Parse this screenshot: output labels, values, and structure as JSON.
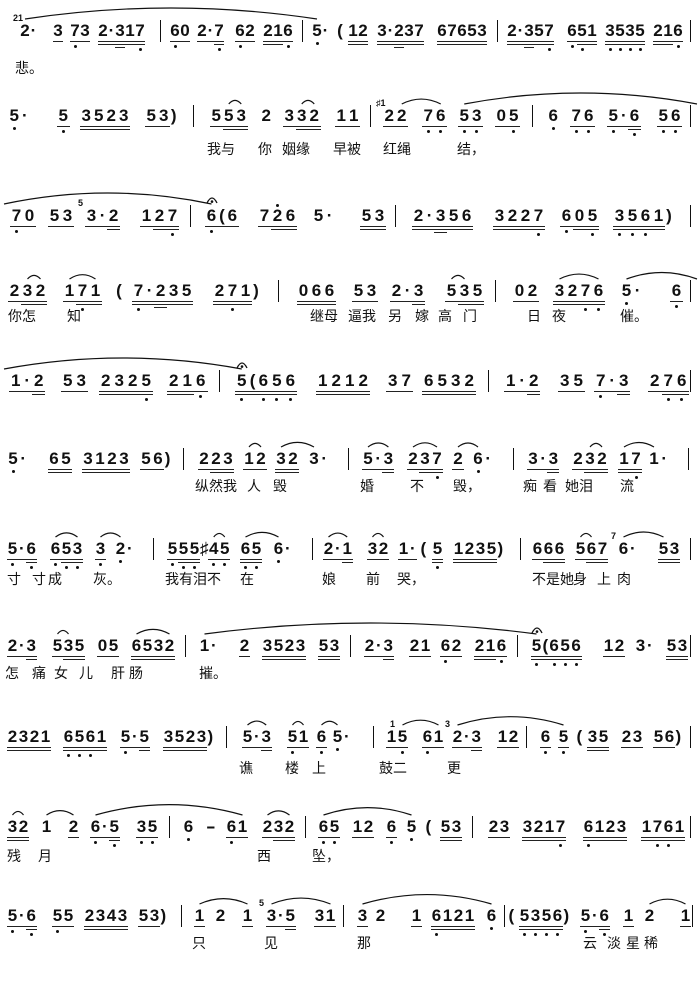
{
  "systems": [
    {
      "items": [
        {
          "t": "2·",
          "u": "00",
          "g": {
            "0": "21"
          },
          "s": "( "
        },
        {
          "t": "3",
          "u": "1"
        },
        {
          "t": "73",
          "u": "11",
          "o": ". "
        },
        {
          "t": "2·317",
          "u": "22322",
          "o": "    ."
        },
        {
          "bar": "|"
        },
        {
          "t": "60",
          "u": "11",
          "o": ". "
        },
        {
          "t": "2·7",
          "u": "112",
          "o": "  ."
        },
        {
          "t": "62",
          "u": "11",
          "o": ". "
        },
        {
          "t": "216",
          "u": "221",
          "o": "  ."
        },
        {
          "bar": "|"
        },
        {
          "t": "5·",
          "u": "00",
          "o": ". ",
          "s": ") "
        },
        {
          "t": "(",
          "u": "0"
        },
        {
          "t": "12",
          "u": "22"
        },
        {
          "t": "3·237",
          "u": "22322"
        },
        {
          "t": "67653",
          "u": "22222"
        },
        {
          "bar": "|"
        },
        {
          "t": "2·357",
          "u": "22322",
          "o": "    ."
        },
        {
          "t": "651",
          "u": "122",
          "o": ".. "
        },
        {
          "t": "3535",
          "u": "2222",
          "o": "...."
        },
        {
          "t": "216",
          "u": "221",
          "o": "  ."
        },
        {
          "bar": "|"
        }
      ],
      "lyrics": [
        {
          "text": "悲。"
        }
      ]
    },
    {
      "items": [
        {
          "t": "5·",
          "u": "00",
          "o": ". "
        },
        {
          "t": "5",
          "u": "1",
          "o": "."
        },
        {
          "t": "3523",
          "u": "2222"
        },
        {
          "t": "53)",
          "u": "110"
        },
        {
          "bar": "|"
        },
        {
          "t": "553",
          "u": "122",
          "s": " ()"
        },
        {
          "t": "2",
          "u": "0"
        },
        {
          "t": "332",
          "u": "122",
          "s": " ()"
        },
        {
          "t": "11",
          "u": "11"
        },
        {
          "bar": "|"
        },
        {
          "t": "22",
          "u": "11",
          "g": {
            "0": "♯1"
          },
          "s": " ("
        },
        {
          "t": "76",
          "u": "11",
          "o": "..",
          "s": " )"
        },
        {
          "t": "53",
          "u": "11",
          "o": "..",
          "s": "[ "
        },
        {
          "t": "05",
          "u": "11",
          "o": " ."
        },
        {
          "bar": "|"
        },
        {
          "t": "6",
          "u": "0",
          "o": "."
        },
        {
          "t": "76",
          "u": "11",
          "o": ".."
        },
        {
          "t": "5·6",
          "u": "112",
          "o": ". ."
        },
        {
          "t": "56",
          "u": "11",
          "o": ".."
        },
        {
          "bar": "|"
        }
      ],
      "lyrics": [
        {
          "text": "我与"
        },
        {
          "text": "你"
        },
        {
          "text": "姻缘"
        },
        {
          "text": "早被"
        },
        {
          "text": "红绳"
        },
        {
          "text": "结，"
        }
      ]
    },
    {
      "items": [
        {
          "t": "70",
          "u": "11",
          "o": ". "
        },
        {
          "t": "53",
          "u": "11"
        },
        {
          "t": "3·2",
          "u": "112",
          "g": {
            "0": "5"
          }
        },
        {
          "t": "127",
          "u": "122",
          "o": "  ."
        },
        {
          "bar": "|"
        },
        {
          "t": "6(6",
          "u": "111",
          "o": ".  ",
          "f": 0,
          "s": "]  "
        },
        {
          "t": "726",
          "u": "122",
          "o": " ' "
        },
        {
          "t": "5·",
          "u": "00"
        },
        {
          "t": "53",
          "u": "22"
        },
        {
          "bar": "|"
        },
        {
          "t": "2·356",
          "u": "22322"
        },
        {
          "t": "3227",
          "u": "2222",
          "o": "   ."
        },
        {
          "t": "605",
          "u": "122",
          "o": ". ."
        },
        {
          "t": "3561)",
          "u": "22220",
          "o": "...  "
        },
        {
          "bar": "|"
        }
      ],
      "lyrics": []
    },
    {
      "items": [
        {
          "t": "232",
          "u": "122",
          "s": " ()"
        },
        {
          "t": "171",
          "u": "122",
          "o": " . ",
          "s": "( )"
        },
        {
          "t": "(",
          "u": "0"
        },
        {
          "t": "7·235",
          "u": "22322",
          "o": ".    "
        },
        {
          "t": "271)",
          "u": "2220",
          "o": " .  "
        },
        {
          "bar": "|"
        },
        {
          "t": "066",
          "u": "222"
        },
        {
          "t": "53",
          "u": "11"
        },
        {
          "t": "2·3",
          "u": "112"
        },
        {
          "t": "535",
          "u": "122",
          "s": "() "
        },
        {
          "bar": "|"
        },
        {
          "t": "02",
          "u": "11"
        },
        {
          "t": "3276",
          "u": "2222",
          "o": "  ..",
          "s": "(  )"
        },
        {
          "t": "5·",
          "u": "00",
          "o": ". ",
          "s": "[ "
        },
        {
          "t": "6",
          "u": "1",
          "o": "."
        },
        {
          "bar": "|"
        }
      ],
      "lyrics": [
        {
          "text": "你怎"
        },
        {
          "text": "知"
        },
        {
          "text": "继母"
        },
        {
          "text": "逼我"
        },
        {
          "text": "另"
        },
        {
          "text": "嫁"
        },
        {
          "text": "高"
        },
        {
          "text": "门"
        },
        {
          "text": "日"
        },
        {
          "text": "夜"
        },
        {
          "text": "催。"
        }
      ]
    },
    {
      "items": [
        {
          "t": "1·2",
          "u": "112"
        },
        {
          "t": "53",
          "u": "11"
        },
        {
          "t": "2325",
          "u": "2222",
          "o": "   ."
        },
        {
          "t": "216",
          "u": "221",
          "o": "  ."
        },
        {
          "bar": "|"
        },
        {
          "t": "5(656",
          "u": "22222",
          "o": ". ...",
          "f": 0,
          "s": "]    "
        },
        {
          "t": "1212",
          "u": "2222"
        },
        {
          "t": "37",
          "u": "11"
        },
        {
          "t": "6532",
          "u": "2222"
        },
        {
          "bar": "|"
        },
        {
          "t": "1·2",
          "u": "112"
        },
        {
          "t": "35",
          "u": "11"
        },
        {
          "t": "7·3",
          "u": "112",
          "o": ".  "
        },
        {
          "t": "276",
          "u": "122",
          "o": " .."
        },
        {
          "bar": "|"
        }
      ],
      "lyrics": []
    },
    {
      "items": [
        {
          "t": "5·",
          "u": "00",
          "o": ". "
        },
        {
          "t": "65",
          "u": "22"
        },
        {
          "t": "3123",
          "u": "2222"
        },
        {
          "t": "56)",
          "u": "110"
        },
        {
          "bar": "|"
        },
        {
          "t": "223",
          "u": "122"
        },
        {
          "t": "12",
          "u": "11",
          "s": "()"
        },
        {
          "t": "32",
          "u": "22",
          "s": "( "
        },
        {
          "t": "3·",
          "u": "00",
          "s": ") "
        },
        {
          "bar": "|"
        },
        {
          "t": "5·3",
          "u": "112",
          "s": "( )"
        },
        {
          "t": "237",
          "u": "122",
          "o": "  .",
          "s": "( )"
        },
        {
          "t": "2",
          "u": "1",
          "s": "("
        },
        {
          "t": "6·",
          "u": "00",
          "o": ". ",
          "s": ") "
        },
        {
          "bar": "|"
        },
        {
          "t": "3·3",
          "u": "112"
        },
        {
          "t": "232",
          "u": "122",
          "s": " ()"
        },
        {
          "t": "17",
          "u": "22",
          "o": " .",
          "s": "( "
        },
        {
          "t": "1·",
          "u": "00",
          "s": ") "
        },
        {
          "bar": "|"
        }
      ],
      "lyrics": [
        {
          "text": "纵然我"
        },
        {
          "text": "人"
        },
        {
          "text": "毁"
        },
        {
          "text": "婚"
        },
        {
          "text": "不"
        },
        {
          "text": "毁，"
        },
        {
          "text": "痴"
        },
        {
          "text": "看"
        },
        {
          "text": "她泪"
        },
        {
          "text": "流"
        }
      ]
    },
    {
      "items": [
        {
          "t": "5·6",
          "u": "112",
          "o": ". ."
        },
        {
          "t": "653",
          "u": "122",
          "o": "...",
          "s": "( )"
        },
        {
          "t": "3",
          "u": "1",
          "o": ".",
          "s": "("
        },
        {
          "t": "2·",
          "u": "00",
          "o": ". ",
          "s": ") "
        },
        {
          "bar": "|"
        },
        {
          "t": "555",
          "u": "122",
          "o": "..."
        },
        {
          "t": "♯45",
          "u": "011",
          "o": " ..",
          "s": " ()"
        },
        {
          "t": "65",
          "u": "22",
          "o": "..",
          "s": "( "
        },
        {
          "t": "6·",
          "u": "00",
          "o": ". ",
          "s": ") "
        },
        {
          "bar": "|"
        },
        {
          "t": "2·1",
          "u": "112",
          "s": "( )"
        },
        {
          "t": "32",
          "u": "11",
          "s": "()"
        },
        {
          "t": "1·",
          "u": "11"
        },
        {
          "t": "(",
          "u": "0"
        },
        {
          "t": "5",
          "u": "2",
          "o": "."
        },
        {
          "t": "1235)",
          "u": "22220"
        },
        {
          "bar": "|"
        },
        {
          "t": "666",
          "u": "122"
        },
        {
          "t": "567",
          "u": "122",
          "s": "() "
        },
        {
          "t": "6·",
          "u": "00",
          "g": {
            "0": "7"
          },
          "s": "( "
        },
        {
          "t": "53",
          "u": "22",
          "s": ") "
        },
        {
          "bar": "|"
        }
      ],
      "lyrics": [
        {
          "text": "寸"
        },
        {
          "text": "寸"
        },
        {
          "text": "成"
        },
        {
          "text": "灰。"
        },
        {
          "text": "我有泪"
        },
        {
          "text": "不"
        },
        {
          "text": "在"
        },
        {
          "text": "娘"
        },
        {
          "text": "前"
        },
        {
          "text": "哭，"
        },
        {
          "text": "不是她"
        },
        {
          "text": "身"
        },
        {
          "text": "上"
        },
        {
          "text": "肉"
        }
      ]
    },
    {
      "items": [
        {
          "t": "2·3",
          "u": "112"
        },
        {
          "t": "535",
          "u": "122",
          "s": "() "
        },
        {
          "t": "05",
          "u": "11"
        },
        {
          "t": "6532",
          "u": "2222",
          "s": "(  )"
        },
        {
          "bar": "|"
        },
        {
          "t": "1·",
          "u": "00",
          "s": "( "
        },
        {
          "t": "2",
          "u": "1"
        },
        {
          "t": "3523",
          "u": "2222"
        },
        {
          "t": "53",
          "u": "22"
        },
        {
          "bar": "|"
        },
        {
          "t": "2·3",
          "u": "112"
        },
        {
          "t": "21",
          "u": "11"
        },
        {
          "t": "62",
          "u": "11",
          "o": ". "
        },
        {
          "t": "216",
          "u": "221",
          "o": "  ."
        },
        {
          "bar": "|"
        },
        {
          "t": "5(656",
          "u": "22222",
          "o": ". ...",
          "f": 0,
          "s": ")    "
        },
        {
          "t": "12",
          "u": "11"
        },
        {
          "t": "3·",
          "u": "00"
        },
        {
          "t": "53",
          "u": "22"
        },
        {
          "bar": "|"
        }
      ],
      "lyrics": [
        {
          "text": "怎"
        },
        {
          "text": "痛"
        },
        {
          "text": "女"
        },
        {
          "text": "儿"
        },
        {
          "text": "肝"
        },
        {
          "text": "肠"
        },
        {
          "text": "摧。"
        }
      ]
    },
    {
      "items": [
        {
          "t": "2321",
          "u": "2222"
        },
        {
          "t": "6561",
          "u": "2222",
          "o": "... "
        },
        {
          "t": "5·5",
          "u": "112",
          "o": ".  "
        },
        {
          "t": "3523)",
          "u": "22220"
        },
        {
          "bar": "|"
        },
        {
          "t": "5·3",
          "u": "112",
          "s": "( )"
        },
        {
          "t": "51",
          "u": "11",
          "o": ". ",
          "s": "()"
        },
        {
          "t": "6",
          "u": "1",
          "o": ".",
          "s": "("
        },
        {
          "t": "5·",
          "u": "00",
          "o": ". ",
          "s": ") "
        },
        {
          "bar": "|"
        },
        {
          "t": "15",
          "u": "11",
          "o": " .",
          "g": {
            "1": "1"
          },
          "s": " ("
        },
        {
          "t": "61",
          "u": "11",
          "o": ". ",
          "s": " )"
        },
        {
          "t": "2·3",
          "u": "112",
          "g": {
            "0": "3"
          },
          "s": "(  "
        },
        {
          "t": "12",
          "u": "11"
        },
        {
          "bar": "|"
        },
        {
          "t": "6",
          "u": "1",
          "o": "."
        },
        {
          "t": "5",
          "u": "1",
          "o": ".",
          "s": ")"
        },
        {
          "t": "(",
          "u": "0"
        },
        {
          "t": "35",
          "u": "22"
        },
        {
          "t": "23",
          "u": "11"
        },
        {
          "t": "56)",
          "u": "110"
        },
        {
          "bar": "|"
        }
      ],
      "lyrics": [
        {
          "text": "谯"
        },
        {
          "text": "楼"
        },
        {
          "text": "上"
        },
        {
          "text": "鼓二"
        },
        {
          "text": "更"
        }
      ]
    },
    {
      "items": [
        {
          "t": "32",
          "u": "22",
          "s": "()"
        },
        {
          "t": "1",
          "u": "0",
          "s": "("
        },
        {
          "t": "2",
          "u": "1",
          "s": ")"
        },
        {
          "t": "6·5",
          "u": "112",
          "o": ". .",
          "s": "(  "
        },
        {
          "t": "35",
          "u": "11",
          "o": ".."
        },
        {
          "bar": "|"
        },
        {
          "t": "6",
          "u": "0",
          "o": "."
        },
        {
          "t": "-",
          "u": "0"
        },
        {
          "t": "61",
          "u": "11",
          "o": ". ",
          "s": " )"
        },
        {
          "t": "232",
          "u": "122",
          "s": "( )"
        },
        {
          "bar": "|"
        },
        {
          "t": "65",
          "u": "11",
          "o": "..",
          "s": "( "
        },
        {
          "t": "12",
          "u": "11"
        },
        {
          "t": "6",
          "u": "1",
          "o": "."
        },
        {
          "t": "5",
          "u": "0",
          "o": ".",
          "s": ")"
        },
        {
          "t": "(",
          "u": "0"
        },
        {
          "t": "53",
          "u": "22"
        },
        {
          "bar": "|"
        },
        {
          "t": "23",
          "u": "11"
        },
        {
          "t": "3217",
          "u": "2222",
          "o": "   ."
        },
        {
          "t": "6123",
          "u": "2222",
          "o": ".   "
        },
        {
          "t": "1761",
          "u": "2222",
          "o": " .. "
        },
        {
          "bar": "|"
        }
      ],
      "lyrics": [
        {
          "text": "残"
        },
        {
          "text": "月"
        },
        {
          "text": "西"
        },
        {
          "text": "坠，"
        }
      ]
    },
    {
      "items": [
        {
          "t": "5·6",
          "u": "112",
          "o": ". ."
        },
        {
          "t": "55",
          "u": "11",
          "o": ". "
        },
        {
          "t": "2343",
          "u": "2222"
        },
        {
          "t": "53)",
          "u": "110"
        },
        {
          "bar": "|"
        },
        {
          "t": "1",
          "u": "1",
          "s": "("
        },
        {
          "t": "2",
          "u": "0"
        },
        {
          "t": "1",
          "u": "1",
          "s": ")"
        },
        {
          "t": "3·5",
          "u": "112",
          "g": {
            "0": "5"
          },
          "s": "(  "
        },
        {
          "t": "31",
          "u": "11",
          "s": " )"
        },
        {
          "bar": "|"
        },
        {
          "t": "3",
          "u": "1",
          "s": "("
        },
        {
          "t": "2",
          "u": "0"
        },
        {
          "t": "1",
          "u": "1"
        },
        {
          "t": "6121",
          "u": "2222",
          "o": ".   "
        },
        {
          "t": "6",
          "u": "0",
          "o": ".",
          "s": ")"
        },
        {
          "bar": "|"
        },
        {
          "t": "(",
          "u": "0"
        },
        {
          "t": "5356)",
          "u": "22220",
          "o": ".... "
        },
        {
          "t": "5·6",
          "u": "112",
          "o": ". ."
        },
        {
          "t": "1",
          "u": "1"
        },
        {
          "t": "2",
          "u": "0",
          "s": "("
        },
        {
          "t": "1",
          "u": "1",
          "s": ")"
        },
        {
          "bar": "|"
        }
      ],
      "lyrics": [
        {
          "text": "只"
        },
        {
          "text": "见"
        },
        {
          "text": "那"
        },
        {
          "text": "云"
        },
        {
          "text": "淡"
        },
        {
          "text": "星"
        },
        {
          "text": "稀"
        }
      ]
    }
  ]
}
